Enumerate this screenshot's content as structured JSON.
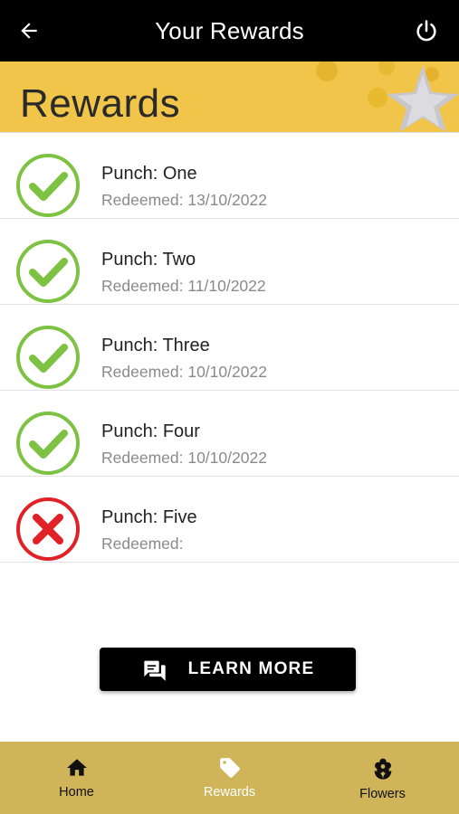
{
  "header": {
    "title": "Your Rewards",
    "back_icon": "arrow-left-icon",
    "power_icon": "power-icon"
  },
  "banner": {
    "heading": "Rewards",
    "color": "#f0c54a"
  },
  "rewards": [
    {
      "name": "Punch: One",
      "redeemed": "Redeemed: 13/10/2022",
      "status": "redeemed"
    },
    {
      "name": "Punch: Two",
      "redeemed": "Redeemed: 11/10/2022",
      "status": "redeemed"
    },
    {
      "name": "Punch: Three",
      "redeemed": "Redeemed: 10/10/2022",
      "status": "redeemed"
    },
    {
      "name": "Punch: Four",
      "redeemed": "Redeemed: 10/10/2022",
      "status": "redeemed"
    },
    {
      "name": "Punch: Five",
      "redeemed": "Redeemed:",
      "status": "not-redeemed"
    }
  ],
  "learn_more": {
    "label": "LEARN MORE",
    "icon": "chat-bubbles-icon"
  },
  "nav": {
    "items": [
      {
        "label": "Home",
        "icon": "home-icon",
        "active": false
      },
      {
        "label": "Rewards",
        "icon": "tag-icon",
        "active": true
      },
      {
        "label": "Flowers",
        "icon": "flower-icon",
        "active": false
      }
    ]
  },
  "colors": {
    "check_green": "#7dc242",
    "cross_red": "#e02127",
    "nav_bg": "#cfb45a"
  }
}
